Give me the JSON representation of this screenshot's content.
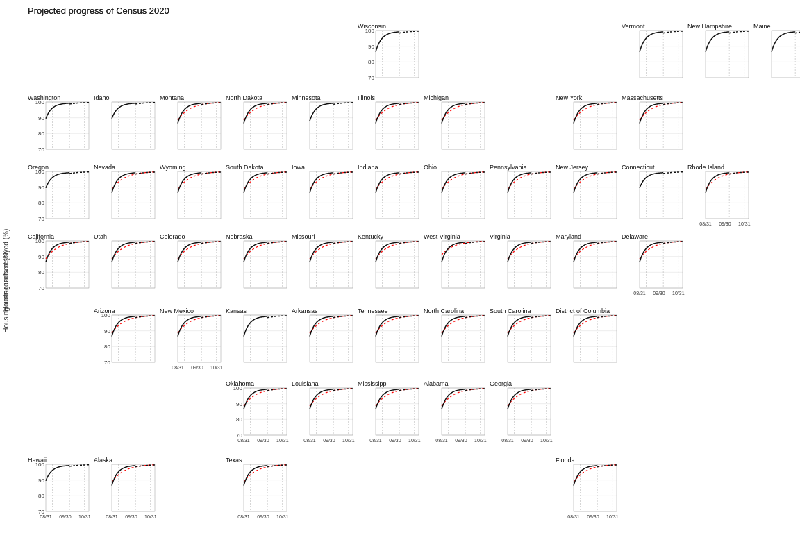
{
  "title": "Projected progress of Census 2020",
  "yAxisLabel": "Housing units resolved (%)",
  "states": [
    {
      "name": "Wisconsin",
      "row": 0,
      "col": 5,
      "blackCurve": true,
      "redCurve": false
    },
    {
      "name": "Vermont",
      "row": 0,
      "col": 9,
      "blackCurve": true,
      "redCurve": false
    },
    {
      "name": "New Hampshire",
      "row": 0,
      "col": 10,
      "blackCurve": true,
      "redCurve": false
    },
    {
      "name": "Maine",
      "row": 0,
      "col": 11,
      "blackCurve": true,
      "redCurve": false
    },
    {
      "name": "Washington",
      "row": 1,
      "col": 0
    },
    {
      "name": "Idaho",
      "row": 1,
      "col": 1
    },
    {
      "name": "Montana",
      "row": 1,
      "col": 2
    },
    {
      "name": "North Dakota",
      "row": 1,
      "col": 3
    },
    {
      "name": "Minnesota",
      "row": 1,
      "col": 4
    },
    {
      "name": "Illinois",
      "row": 1,
      "col": 5
    },
    {
      "name": "Michigan",
      "row": 1,
      "col": 6
    },
    {
      "name": "New York",
      "row": 1,
      "col": 8
    },
    {
      "name": "Massachusetts",
      "row": 1,
      "col": 9
    },
    {
      "name": "Oregon",
      "row": 2,
      "col": 0
    },
    {
      "name": "Nevada",
      "row": 2,
      "col": 1
    },
    {
      "name": "Wyoming",
      "row": 2,
      "col": 2
    },
    {
      "name": "South Dakota",
      "row": 2,
      "col": 3
    },
    {
      "name": "Iowa",
      "row": 2,
      "col": 4
    },
    {
      "name": "Indiana",
      "row": 2,
      "col": 5
    },
    {
      "name": "Ohio",
      "row": 2,
      "col": 6
    },
    {
      "name": "Pennsylvania",
      "row": 2,
      "col": 7
    },
    {
      "name": "New Jersey",
      "row": 2,
      "col": 8
    },
    {
      "name": "Connecticut",
      "row": 2,
      "col": 9
    },
    {
      "name": "Rhode Island",
      "row": 2,
      "col": 10
    },
    {
      "name": "California",
      "row": 3,
      "col": 0
    },
    {
      "name": "Utah",
      "row": 3,
      "col": 1
    },
    {
      "name": "Colorado",
      "row": 3,
      "col": 2
    },
    {
      "name": "Nebraska",
      "row": 3,
      "col": 3
    },
    {
      "name": "Missouri",
      "row": 3,
      "col": 4
    },
    {
      "name": "Kentucky",
      "row": 3,
      "col": 5
    },
    {
      "name": "West Virginia",
      "row": 3,
      "col": 6
    },
    {
      "name": "Virginia",
      "row": 3,
      "col": 7
    },
    {
      "name": "Maryland",
      "row": 3,
      "col": 8
    },
    {
      "name": "Delaware",
      "row": 3,
      "col": 9
    },
    {
      "name": "Arizona",
      "row": 4,
      "col": 1
    },
    {
      "name": "New Mexico",
      "row": 4,
      "col": 2
    },
    {
      "name": "Kansas",
      "row": 4,
      "col": 3
    },
    {
      "name": "Arkansas",
      "row": 4,
      "col": 4
    },
    {
      "name": "Tennessee",
      "row": 4,
      "col": 5
    },
    {
      "name": "North Carolina",
      "row": 4,
      "col": 6
    },
    {
      "name": "South Carolina",
      "row": 4,
      "col": 7
    },
    {
      "name": "District of Columbia",
      "row": 4,
      "col": 8
    },
    {
      "name": "Oklahoma",
      "row": 5,
      "col": 3
    },
    {
      "name": "Louisiana",
      "row": 5,
      "col": 4
    },
    {
      "name": "Mississippi",
      "row": 5,
      "col": 5
    },
    {
      "name": "Alabama",
      "row": 5,
      "col": 6
    },
    {
      "name": "Georgia",
      "row": 5,
      "col": 7
    },
    {
      "name": "Hawaii",
      "row": 6,
      "col": 0
    },
    {
      "name": "Alaska",
      "row": 6,
      "col": 1
    },
    {
      "name": "Texas",
      "row": 6,
      "col": 3
    },
    {
      "name": "Florida",
      "row": 6,
      "col": 8
    }
  ],
  "xLabels": [
    "08/31",
    "09/30",
    "10/31"
  ]
}
